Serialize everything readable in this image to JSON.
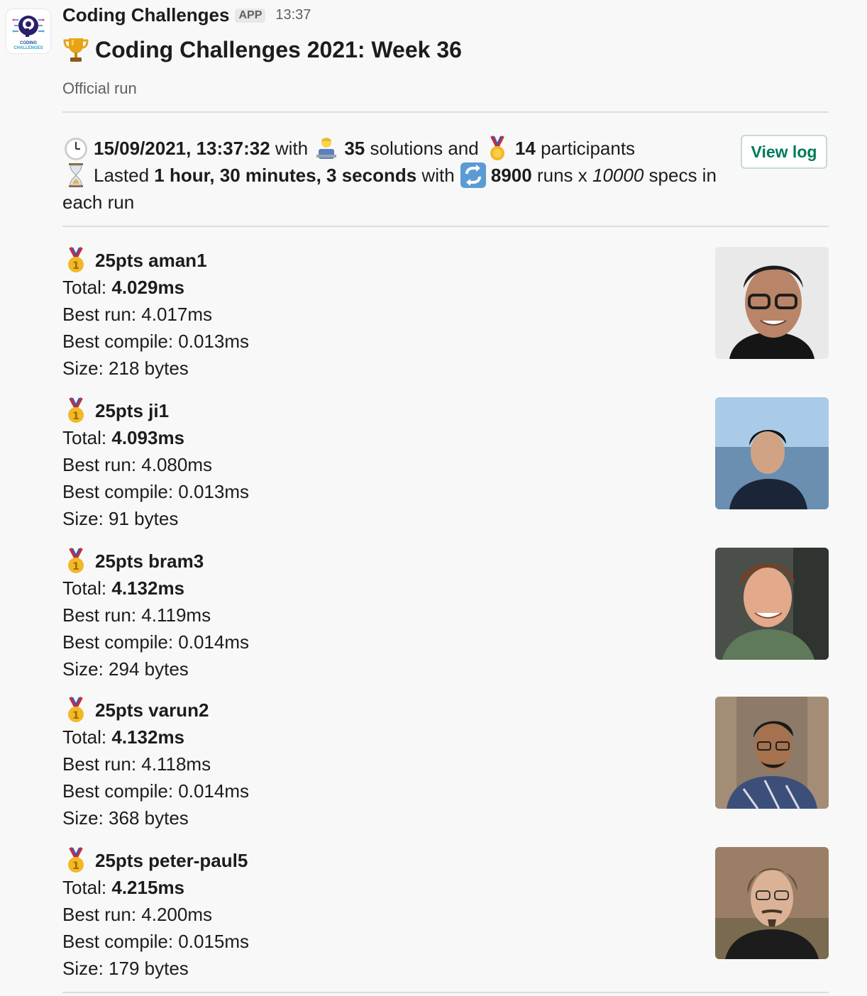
{
  "app": {
    "name": "Coding Challenges",
    "badge": "APP",
    "time": "13:37",
    "logo_text_line1": "CODING",
    "logo_text_line2": "CHALLENGES"
  },
  "message": {
    "title_emoji": "trophy-icon",
    "title": "Coding Challenges 2021: Week 36",
    "subtitle": "Official run"
  },
  "summary": {
    "datetime": "15/09/2021, 13:37:32",
    "with_1": " with ",
    "solutions_count": "35",
    "solutions_text": " solutions and ",
    "participants_count": "14",
    "participants_text": " participants",
    "lasted_label": "Lasted ",
    "duration": "1 hour, 30 minutes, 3 seconds",
    "with_2": " with ",
    "runs_count": "8900",
    "runs_text": " runs x ",
    "specs_count": "10000",
    "specs_text": " specs in each run"
  },
  "view_log_label": "View log",
  "results": [
    {
      "heading": "25pts aman1",
      "total_label": "Total: ",
      "total": "4.029ms",
      "best_run": "Best run: 4.017ms",
      "best_compile": "Best compile: 0.013ms",
      "size": "Size: 218 bytes"
    },
    {
      "heading": "25pts ji1",
      "total_label": "Total: ",
      "total": "4.093ms",
      "best_run": "Best run: 4.080ms",
      "best_compile": "Best compile: 0.013ms",
      "size": "Size: 91 bytes"
    },
    {
      "heading": "25pts bram3",
      "total_label": "Total: ",
      "total": "4.132ms",
      "best_run": "Best run: 4.119ms",
      "best_compile": "Best compile: 0.014ms",
      "size": "Size: 294 bytes"
    },
    {
      "heading": "25pts varun2",
      "total_label": "Total: ",
      "total": "4.132ms",
      "best_run": "Best run: 4.118ms",
      "best_compile": "Best compile: 0.014ms",
      "size": "Size: 368 bytes"
    },
    {
      "heading": "25pts peter-paul5",
      "total_label": "Total: ",
      "total": "4.215ms",
      "best_run": "Best run: 4.200ms",
      "best_compile": "Best compile: 0.015ms",
      "size": "Size: 179 bytes"
    }
  ],
  "colors": {
    "link_green": "#007a5a",
    "muted": "#616061",
    "divider": "#dddddd"
  }
}
